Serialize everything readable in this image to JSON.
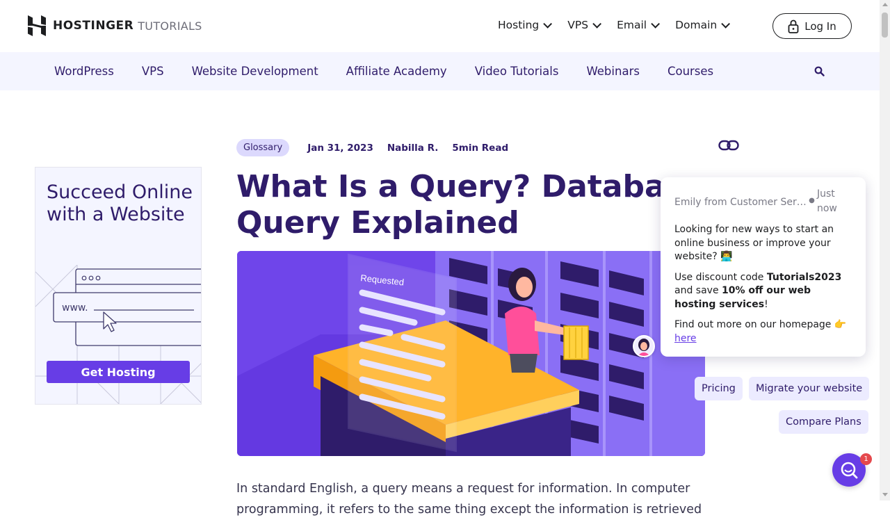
{
  "header": {
    "brand": "HOSTINGER",
    "brand_sub": "TUTORIALS",
    "nav": [
      {
        "label": "Hosting"
      },
      {
        "label": "VPS"
      },
      {
        "label": "Email"
      },
      {
        "label": "Domain"
      }
    ],
    "login_label": "Log In"
  },
  "categories": [
    {
      "label": "WordPress"
    },
    {
      "label": "VPS"
    },
    {
      "label": "Website Development"
    },
    {
      "label": "Affiliate Academy"
    },
    {
      "label": "Video Tutorials"
    },
    {
      "label": "Webinars"
    },
    {
      "label": "Courses"
    }
  ],
  "ad": {
    "title": "Succeed Online with a Website",
    "url_text": "www.",
    "button": "Get Hosting"
  },
  "article": {
    "tag": "Glossary",
    "date": "Jan 31, 2023",
    "author": "Nabilla R.",
    "read_time": "5min Read",
    "title": "What Is a Query? Database Query Explained",
    "hero_label": "Requested",
    "intro": "In standard English, a query means a request for information. In computer programming, it refers to the same thing except the information is retrieved"
  },
  "chat": {
    "sender": "Emily from Customer Service",
    "time": "Just now",
    "p1": "Looking for new ways to start an online business or improve your website? 👨‍💻",
    "p2_pre": "Use discount code ",
    "p2_code": "Tutorials2023",
    "p2_mid": " and save ",
    "p2_offer": "10% off our web hosting services",
    "p2_post": "!",
    "p3": "Find out more on our homepage 👉 ",
    "p3_link": "here",
    "quick_replies": [
      "Pricing",
      "Migrate your website",
      "Compare Plans"
    ],
    "badge_count": "1"
  },
  "colors": {
    "primary": "#673de6",
    "dark_purple": "#2f1c6a",
    "tag_bg": "#dcd9fd",
    "cat_bar_bg": "#f4f5ff"
  }
}
